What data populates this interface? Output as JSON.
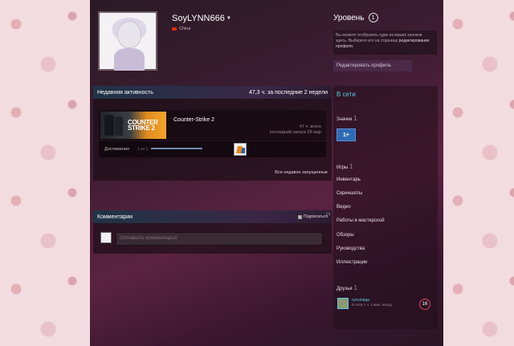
{
  "profile": {
    "username": "SoyLYNN666",
    "location": "China",
    "level_title": "Уровень",
    "level_value": "1",
    "level_note_prefix": "Вы можете отобразить один из ваших значков здесь. Выберите его на странице ",
    "level_note_link": "редактирования профиля",
    "level_note_suffix": ".",
    "edit_profile_label": "Редактировать профиль"
  },
  "activity": {
    "header_title": "Недавняя активность",
    "header_hours": "47,3 ч. за последние 2 недели",
    "game": {
      "name": "Counter-Strike 2",
      "capsule_text_1": "COUNTER",
      "capsule_text_2": "STRIKE 2",
      "hours_total": "47 ч. всего",
      "last_played": "последний запуск 25 мар"
    },
    "achievements": {
      "label": "Достижения",
      "count": "1 из 1",
      "progress": 1
    },
    "all_recent_label": "Все недавно запущенные"
  },
  "comments": {
    "header_title": "Комментарии",
    "subscribe_label": "Подписаться",
    "help_label": "[?]",
    "placeholder": "Оставить комментарий"
  },
  "sidebar": {
    "online_label": "В сети",
    "badges_label": "Значки",
    "badges_count": "1",
    "badge_text": "1+",
    "games_label": "Игры",
    "games_count": "1",
    "links": [
      "Инвентарь",
      "Скриншоты",
      "Видео",
      "Работы в мастерской",
      "Обзоры",
      "Руководства",
      "Иллюстрации"
    ],
    "friends_label": "Друзья",
    "friends_count": "1",
    "friend": {
      "name": "ryzumaqa",
      "status": "В сети 1 ч. 1 мин. назад",
      "level": "16"
    }
  },
  "colors": {
    "accent_online": "#57cbde",
    "badge_blue": "#2e6bb7",
    "friend_level_ring": "#d24b5c"
  }
}
